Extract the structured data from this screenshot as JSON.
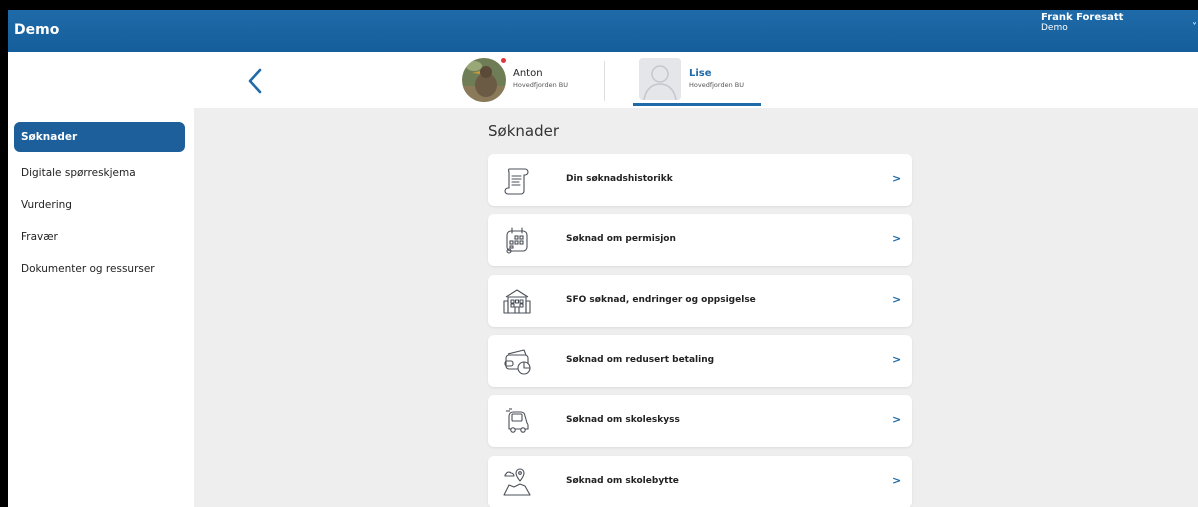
{
  "header": {
    "app_title": "Demo",
    "user_name": "Frank Foresatt",
    "user_org": "Demo",
    "menu_chevron": "˅"
  },
  "children": [
    {
      "name": "Anton",
      "unit": "Hovedfjorden BU",
      "has_notification": true,
      "selected": false
    },
    {
      "name": "Lise",
      "unit": "Hovedfjorden BU",
      "has_notification": false,
      "selected": true
    }
  ],
  "sidebar": {
    "items": [
      {
        "label": "Søknader",
        "active": true
      },
      {
        "label": "Digitale spørreskjema",
        "active": false
      },
      {
        "label": "Vurdering",
        "active": false
      },
      {
        "label": "Fravær",
        "active": false
      },
      {
        "label": "Dokumenter og ressurser",
        "active": false
      }
    ]
  },
  "main": {
    "title": "Søknader",
    "cards": [
      {
        "label": "Din søknadshistorikk",
        "icon": "scroll-icon",
        "chevron": ">"
      },
      {
        "label": "Søknad om permisjon",
        "icon": "calendar-icon",
        "chevron": ">"
      },
      {
        "label": "SFO søknad, endringer og oppsigelse",
        "icon": "school-building-icon",
        "chevron": ">"
      },
      {
        "label": "Søknad om redusert betaling",
        "icon": "wallet-icon",
        "chevron": ">"
      },
      {
        "label": "Søknad om skoleskyss",
        "icon": "car-icon",
        "chevron": ">"
      },
      {
        "label": "Søknad om skolebytte",
        "icon": "map-pin-icon",
        "chevron": ">"
      }
    ]
  },
  "colors": {
    "accent": "#1f6aa8",
    "sidebar_active": "#1d5f9b",
    "content_bg": "#eeeeee",
    "notification": "#e2343c"
  }
}
